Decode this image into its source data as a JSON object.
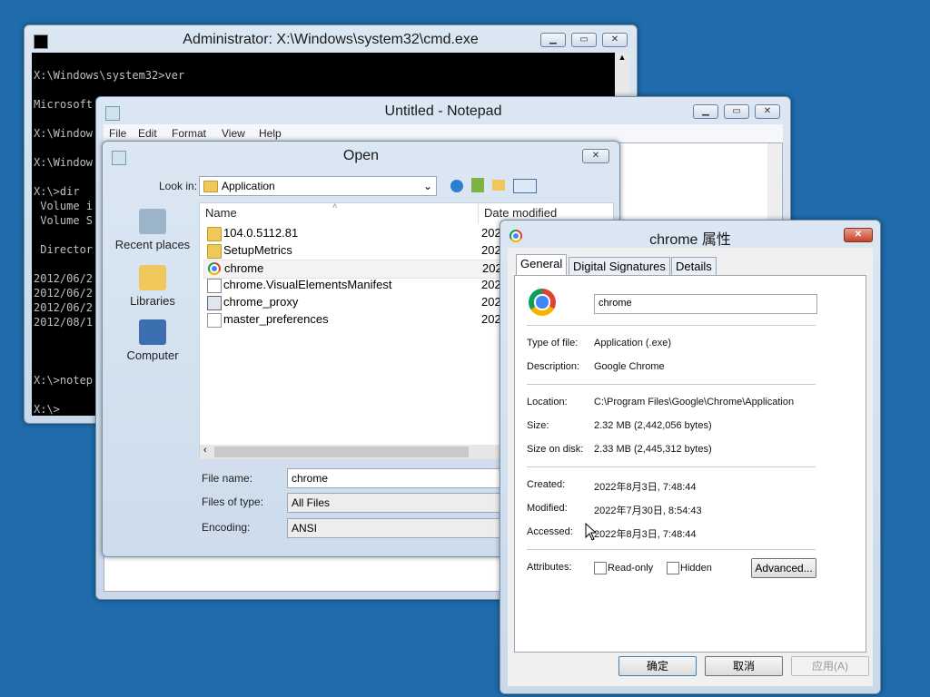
{
  "cmd": {
    "title": "Administrator: X:\\Windows\\system32\\cmd.exe",
    "lines": [
      "X:\\Windows\\system32>ver",
      "Microsoft",
      "X:\\Window",
      "X:\\Window",
      "X:\\>dir",
      " Volume i",
      " Volume S",
      " Director",
      "2012/06/2",
      "2012/06/2",
      "2012/06/2",
      "2012/08/1",
      "X:\\>notep",
      "X:\\>"
    ]
  },
  "notepad": {
    "title": "Untitled - Notepad",
    "menu": [
      "File",
      "Edit",
      "Format",
      "View",
      "Help"
    ]
  },
  "open": {
    "title": "Open",
    "look_in_label": "Look in:",
    "look_in_value": "Application",
    "places": [
      "Recent places",
      "Libraries",
      "Computer"
    ],
    "col_name": "Name",
    "col_date": "Date modified",
    "files": [
      {
        "name": "104.0.5112.81",
        "type": "folder",
        "date": "202"
      },
      {
        "name": "SetupMetrics",
        "type": "folder",
        "date": "202"
      },
      {
        "name": "chrome",
        "type": "chrome",
        "date": "202"
      },
      {
        "name": "chrome.VisualElementsManifest",
        "type": "xml",
        "date": "202"
      },
      {
        "name": "chrome_proxy",
        "type": "exe",
        "date": "202"
      },
      {
        "name": "master_preferences",
        "type": "file",
        "date": "202"
      }
    ],
    "file_name_label": "File name:",
    "file_name_value": "chrome",
    "files_of_type_label": "Files of type:",
    "files_of_type_value": "All Files",
    "encoding_label": "Encoding:",
    "encoding_value": "ANSI"
  },
  "props": {
    "title": "chrome 属性",
    "tabs": [
      "General",
      "Digital Signatures",
      "Details"
    ],
    "name_value": "chrome",
    "type_label": "Type of file:",
    "type_value": "Application (.exe)",
    "desc_label": "Description:",
    "desc_value": "Google Chrome",
    "loc_label": "Location:",
    "loc_value": "C:\\Program Files\\Google\\Chrome\\Application",
    "size_label": "Size:",
    "size_value": "2.32 MB (2,442,056 bytes)",
    "sod_label": "Size on disk:",
    "sod_value": "2.33 MB (2,445,312 bytes)",
    "created_label": "Created:",
    "created_value": "2022年8月3日, 7:48:44",
    "modified_label": "Modified:",
    "modified_value": "2022年7月30日, 8:54:43",
    "accessed_label": "Accessed:",
    "accessed_value": "2022年8月3日, 7:48:44",
    "attr_label": "Attributes:",
    "readonly_label": "Read-only",
    "hidden_label": "Hidden",
    "advanced_label": "Advanced...",
    "ok_label": "确定",
    "cancel_label": "取消",
    "apply_label": "应用(A)"
  }
}
